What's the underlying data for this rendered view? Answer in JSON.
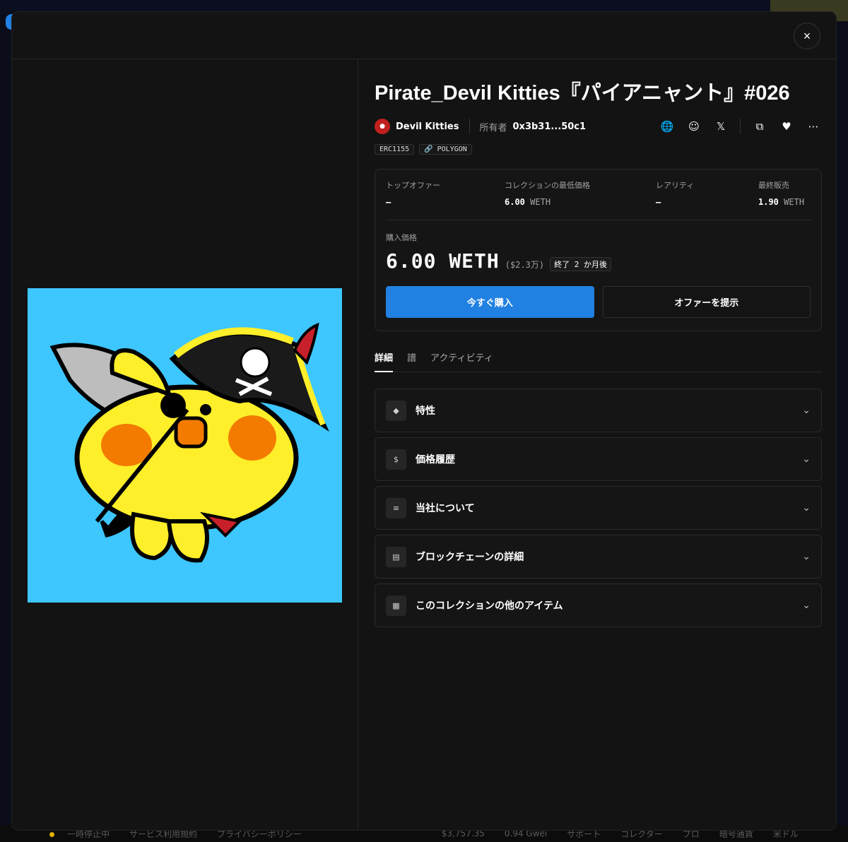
{
  "footer": {
    "items": [
      "一時停止中",
      "サービス利用規約",
      "プライバシーポリシー",
      "$3,757.35",
      "0.94 Gwei",
      "サポート",
      "コレクター",
      "プロ",
      "暗号通貨",
      "米ドル"
    ]
  },
  "modal": {
    "close_icon": "×"
  },
  "nft": {
    "title": "Pirate_Devil Kitties『パイアニャント』#026",
    "collection_name": "Devil Kitties",
    "owner_label": "所有者",
    "owner_address": "0x3b31...50c1",
    "tags": [
      "ERC1155",
      "POLYGON"
    ],
    "tag_link_icon": "🔗",
    "icons": {
      "website": "🌐",
      "discord": "☺",
      "x": "𝕏",
      "copy": "⧉",
      "favorite": "♥",
      "more": "⋯"
    }
  },
  "stats": [
    {
      "label": "トップオファー",
      "value": "–",
      "unit": ""
    },
    {
      "label": "コレクションの最低価格",
      "value": "6.00",
      "unit": "WETH"
    },
    {
      "label": "レアリティ",
      "value": "–",
      "unit": ""
    },
    {
      "label": "最終販売",
      "value": "1.90",
      "unit": "WETH"
    }
  ],
  "purchase": {
    "label": "購入価格",
    "price": "6.00 WETH",
    "usd": "($2.3万)",
    "ends": "終了 2 か月後",
    "buy_now": "今すぐ購入",
    "make_offer": "オファーを提示"
  },
  "tabs": [
    "詳細",
    "譜",
    "アクティビティ"
  ],
  "accordions": [
    {
      "label": "特性",
      "icon": "◆"
    },
    {
      "label": "価格履歴",
      "icon": "$"
    },
    {
      "label": "当社について",
      "icon": "≡"
    },
    {
      "label": "ブロックチェーンの詳細",
      "icon": "▤"
    },
    {
      "label": "このコレクションの他のアイテム",
      "icon": "▦"
    }
  ],
  "chevron": "⌄",
  "colors": {
    "accent": "#2081e2",
    "image_bg": "#3ec6ff",
    "character": "#ffee2a"
  }
}
